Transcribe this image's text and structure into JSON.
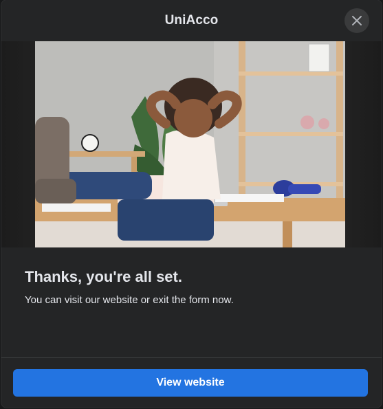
{
  "dialog": {
    "title": "UniAcco",
    "close_icon": "close-icon",
    "image_alt": "person-relaxing-at-desk-photo",
    "heading": "Thanks, you're all set.",
    "subtext": "You can visit our website or exit the form now.",
    "primary_button_label": "View website"
  },
  "colors": {
    "background": "#242526",
    "primary": "#2374e1",
    "text": "#e4e6eb"
  }
}
